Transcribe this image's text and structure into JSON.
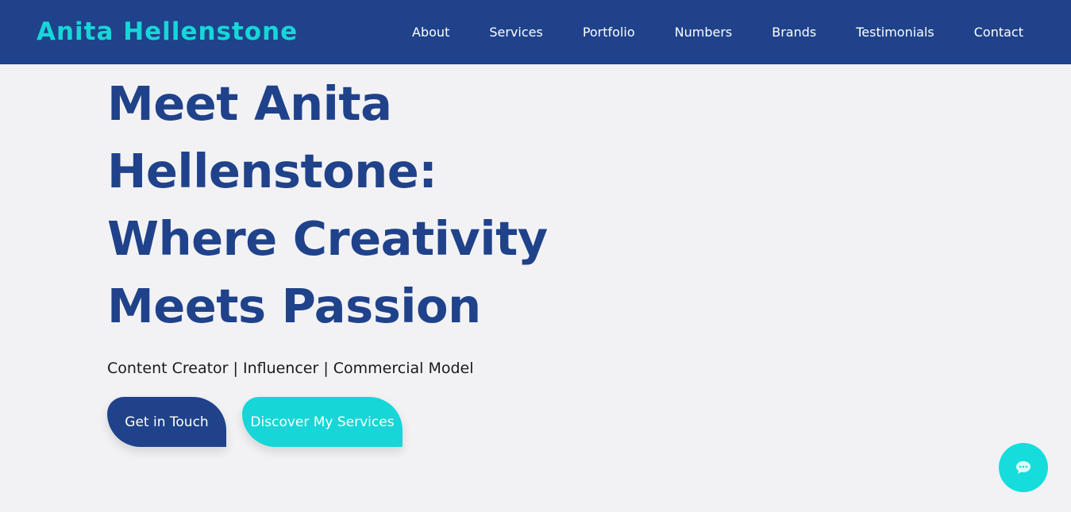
{
  "header": {
    "brand": "Anita Hellenstone",
    "nav": [
      {
        "label": "About"
      },
      {
        "label": "Services"
      },
      {
        "label": "Portfolio"
      },
      {
        "label": "Numbers"
      },
      {
        "label": "Brands"
      },
      {
        "label": "Testimonials"
      },
      {
        "label": "Contact"
      }
    ]
  },
  "hero": {
    "title": "Meet Anita Hellenstone: Where Creativity Meets Passion",
    "subtitle": "Content Creator | Influencer | Commercial Model"
  },
  "cta": {
    "primary_label": "Get in Touch",
    "secondary_label": "Discover My Services"
  },
  "chat": {
    "icon": "chat-bubble-icon"
  },
  "colors": {
    "navbar": "#1f428a",
    "brand": "#16d6d8",
    "title": "#1f428a",
    "page_background": "#f2f2f5",
    "secondary_button": "#16d6d8",
    "chat_button": "#16dcdc"
  }
}
